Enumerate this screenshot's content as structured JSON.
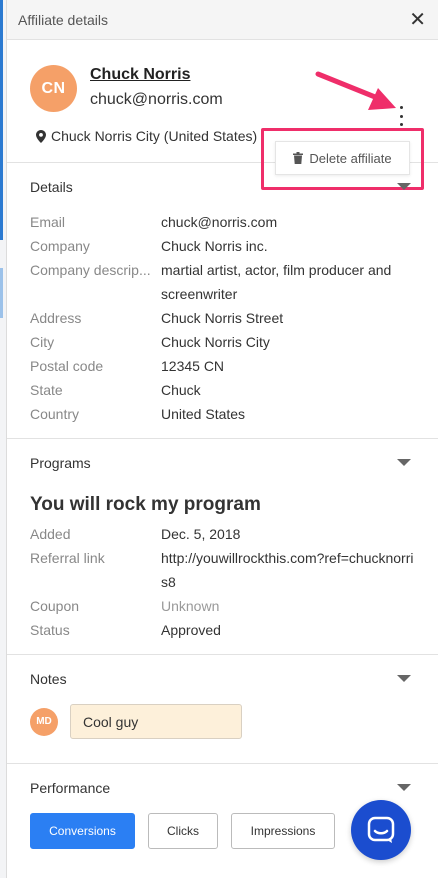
{
  "header": {
    "title": "Affiliate details",
    "close_glyph": "✕"
  },
  "profile": {
    "initials": "CN",
    "name": "Chuck Norris",
    "email": "chuck@norris.com",
    "location": "Chuck Norris City (United States)",
    "delete_label": "Delete affiliate"
  },
  "details": {
    "title": "Details",
    "rows": [
      {
        "label": "Email",
        "value": "chuck@norris.com"
      },
      {
        "label": "Company",
        "value": "Chuck Norris inc."
      },
      {
        "label": "Company descrip...",
        "value": "martial artist, actor, film producer and screenwriter"
      },
      {
        "label": "Address",
        "value": "Chuck Norris Street"
      },
      {
        "label": "City",
        "value": "Chuck Norris City"
      },
      {
        "label": "Postal code",
        "value": "12345 CN"
      },
      {
        "label": "State",
        "value": "Chuck"
      },
      {
        "label": "Country",
        "value": "United States"
      }
    ]
  },
  "programs": {
    "title": "Programs",
    "program_name": "You will rock my program",
    "rows": [
      {
        "label": "Added",
        "value": "Dec. 5, 2018"
      },
      {
        "label": "Referral link",
        "value": "http://youwillrockthis.com?ref=chucknorris8"
      },
      {
        "label": "Coupon",
        "value": "Unknown"
      },
      {
        "label": "Status",
        "value": "Approved"
      }
    ]
  },
  "notes": {
    "title": "Notes",
    "author_initials": "MD",
    "note_text": "Cool guy"
  },
  "performance": {
    "title": "Performance",
    "buttons": [
      "Conversions",
      "Clicks",
      "Impressions"
    ],
    "active_button": "Conversions"
  },
  "colors": {
    "avatar": "#f5a068",
    "highlight": "#ef2e6a",
    "primary_blue": "#2b7ff3",
    "chat_fab": "#1b4dcf",
    "note_bg": "#fdf0da"
  },
  "icons": [
    "close-icon",
    "map-pin-icon",
    "kebab-menu-icon",
    "trash-icon",
    "chevron-down-icon",
    "chat-icon",
    "arrow-annotation"
  ]
}
